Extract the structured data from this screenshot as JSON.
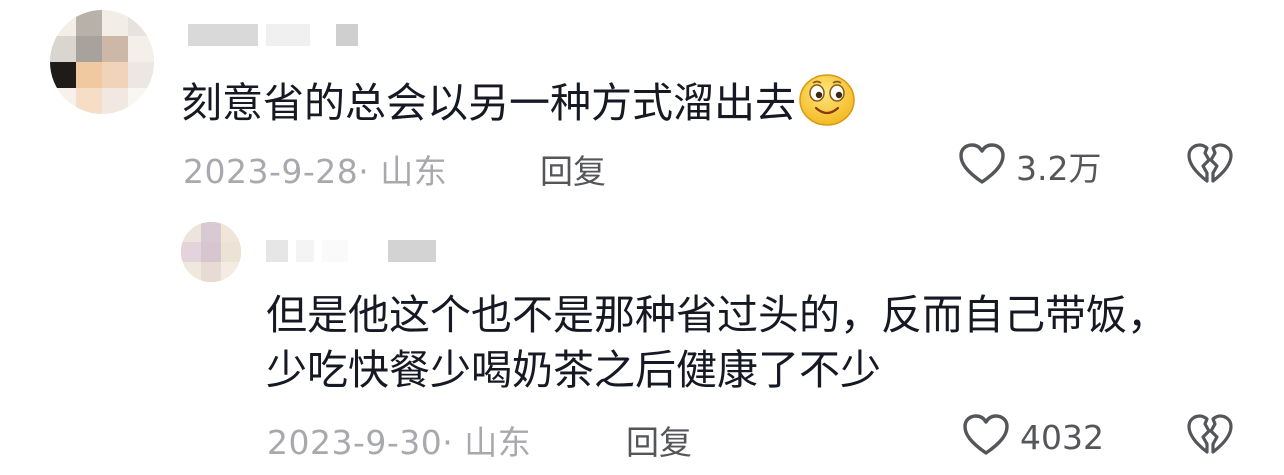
{
  "comment": {
    "text": "刻意省的总会以另一种方式溜出去",
    "emoji_icon": "smiling-face-emoji",
    "date_location": "2023-9-28· 山东",
    "reply_label": "回复",
    "like_count": "3.2万",
    "avatar_colors": [
      "#f3eee8",
      "#b7b1a9",
      "#f2ede7",
      "#e6e2dd",
      "#d8d6cf",
      "#a7a29c",
      "#cdb7a7",
      "#f4efe9",
      "#1e1b19",
      "#f1c9a0",
      "#f0d3b9",
      "#ece7e2",
      "#f6f1eb",
      "#f5ddc6",
      "#f1e9e1",
      "#faf6f2"
    ]
  },
  "reply": {
    "text": "但是他这个也不是那种省过头的，反而自己带饭，少吃快餐少喝奶茶之后健康了不少",
    "date_location": "2023-9-30· 山东",
    "reply_label": "回复",
    "like_count": "4032",
    "avatar_colors": [
      "#ede4dd",
      "#d9c9d2",
      "#efe5d9",
      "#e3d3db",
      "#d7c6d0",
      "#ece2d6",
      "#f1e8dd",
      "#e8dbd3",
      "#f4ece2"
    ]
  },
  "icons": {
    "like": "heart-outline-icon",
    "dislike": "broken-heart-icon"
  },
  "colors": {
    "text_primary": "#161823",
    "text_meta": "#a8a9ad",
    "text_action": "#555659"
  }
}
